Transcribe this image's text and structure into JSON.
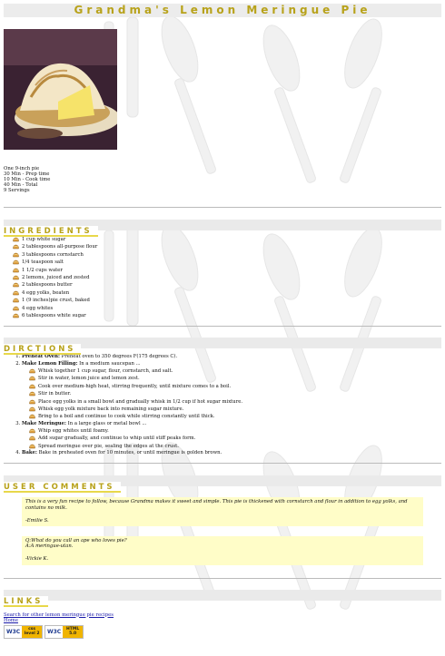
{
  "page": {
    "title": "Grandma's Lemon Meringue Pie",
    "meta": [
      "One 9-inch pie",
      "30 Min - Prep time",
      "10 Min - Cook time",
      "40 Min - Total",
      "9 Servings"
    ]
  },
  "ingredients": {
    "heading": "INGREDIENTS",
    "items": [
      "1 cup white sugar",
      "2 tablespoons all-purpose flour",
      "3 tablespoons cornstarch",
      "1/4 teaspoon salt",
      "1 1/2 cups water",
      "2 lemons, juiced and zested",
      "2 tablespoons butter",
      "4 egg yolks, beaten",
      "1 (9 inches)pie crust, baked",
      "4 egg whites",
      "6 tablespoons white sugar"
    ]
  },
  "directions": {
    "heading": "DIRCTIONS",
    "step1_label": "Preheat Oven:",
    "step1_text": " Preheat oven to 350 degrees F(175 degrees C).",
    "step2_label": "Make Lemon Filling:",
    "step2_text": " In a medium saucepan ...",
    "step2_items": [
      "Whisk together 1 cup sugar, flour, cornstarch, and salt.",
      "Stir in water, lemon juice and lemon zest.",
      "Cook over medium-high heat, stirring frequently, until mixture comes to a boil.",
      "Stir in butter.",
      "Place egg yolks in a small bowl and gradually whisk in 1/2 cup if hot sugar mixture.",
      "Whisk egg yolk mixture back into remaining sugar mixture.",
      "Bring to a boil and continue to cook while stirring constantly until thick."
    ],
    "step3_label": "Make Meringue:",
    "step3_text": " In a large glass or metal bowl ...",
    "step3_items": [
      "Whip egg whites until foamy.",
      "Add sugar gradually, and continue to whip until stiff peaks form.",
      "Spread meringue over pie, sealing the edges at the crust."
    ],
    "step4_label": "Bake:",
    "step4_text": " Bake in preheated oven for 10 minutes, or until meringue is golden brown."
  },
  "comments": {
    "heading": "USER COMMENTS",
    "c1_text": "This is a very fun recipe to follow, because Grandma makes it sweet and simple. This pie is thickened with cornstarch and flour in addition to egg yolks, and contains no milk.",
    "c1_sig": "-Emilie S.",
    "c2_q": "Q:What do you call an ape who loves pie?",
    "c2_a": "A:A meringue-utan.",
    "c2_sig": "-Vickie K."
  },
  "links": {
    "heading": "LINKS",
    "search_link": "Search for other lemon meringue pie recipes",
    "home_link": "Home",
    "badge_css": {
      "org": "W3C",
      "line1": "css",
      "line2": "level 2"
    },
    "badge_html": {
      "org": "W3C",
      "line1": "HTML",
      "line2": "5.0"
    }
  },
  "colors": {
    "heading_gold": "#b8a21a",
    "comment_bg": "#fffdc8",
    "link_blue": "#1a1aaa"
  }
}
